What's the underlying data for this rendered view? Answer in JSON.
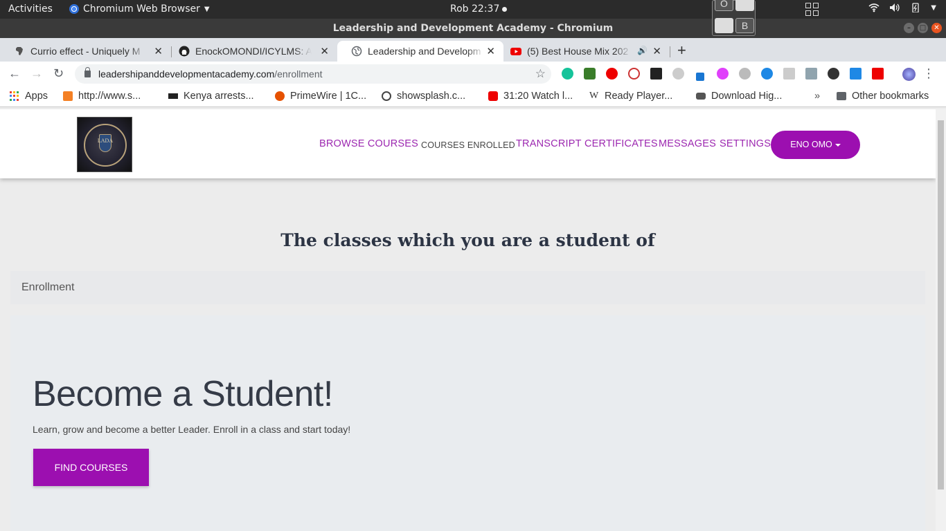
{
  "system_bar": {
    "activities": "Activities",
    "app_name": "Chromium Web Browser",
    "clock": "Rob 22:37",
    "tray_icons": [
      "network-icon",
      "volume-icon",
      "battery-icon",
      "power-menu-icon"
    ]
  },
  "keyboard_widget": {
    "keys": [
      "O",
      "",
      "",
      "B"
    ]
  },
  "window": {
    "title": "Leadership and Development Academy - Chromium"
  },
  "tabs": [
    {
      "title": "Currio effect - Uniquely M",
      "icon": "africa-icon",
      "active": false
    },
    {
      "title": "EnockOMONDI/ICYLMS: A",
      "icon": "github-icon",
      "active": false
    },
    {
      "title": "Leadership and Developm",
      "icon": "globe-icon",
      "active": true
    },
    {
      "title": "(5) Best House Mix 202",
      "icon": "youtube-icon",
      "active": false,
      "audio": true
    }
  ],
  "omnibox": {
    "host": "leadershipanddevelopmentacademy.com",
    "path": "/enrollment"
  },
  "extensions": [
    "grammarly-icon",
    "globe-ext-icon",
    "adblock-icon",
    "ext-red-icon",
    "ext-box-icon",
    "ext-gray-icon",
    "ext-pen-icon",
    "ext-bird-icon",
    "ext-web-icon",
    "ext-blue-icon",
    "ext-key-icon",
    "download-icon",
    "ext-k-icon",
    "ext-bookmark-icon",
    "ext-n-icon",
    "profile-avatar-icon"
  ],
  "bookmarks": [
    {
      "label": "Apps",
      "icon": "apps-grid-icon"
    },
    {
      "label": "http://www.s...",
      "icon": "bookmark-icon"
    },
    {
      "label": "Kenya arrests...",
      "icon": "bbc-icon"
    },
    {
      "label": "PrimeWire | 1C...",
      "icon": "primewire-icon"
    },
    {
      "label": "showsplash.c...",
      "icon": "globe-icon"
    },
    {
      "label": "31:20 Watch l...",
      "icon": "youtube-icon"
    },
    {
      "label": "Ready Player...",
      "icon": "wikipedia-icon"
    },
    {
      "label": "Download Hig...",
      "icon": "car-icon"
    }
  ],
  "bookmarks_overflow": "»",
  "other_bookmarks": "Other bookmarks",
  "site": {
    "logo_text": "LADA",
    "nav": {
      "browse": "BROWSE COURSES",
      "enrolled": "COURSES ENROLLED",
      "transcript": "TRANSCRIPT",
      "certificates": "CERTIFICATES",
      "messages": "MESSAGES",
      "settings": "SETTINGS",
      "user": "ENO OMO"
    },
    "heading": "The classes which you are a student of",
    "breadcrumb": "Enrollment",
    "hero": {
      "title": "Become a Student!",
      "lead": "Learn, grow and become a better Leader. Enroll in a class and start today!",
      "button": "FIND COURSES"
    }
  },
  "colors": {
    "accent": "#9c0fb0",
    "link": "#9c27b0",
    "heading": "#2c3444"
  }
}
